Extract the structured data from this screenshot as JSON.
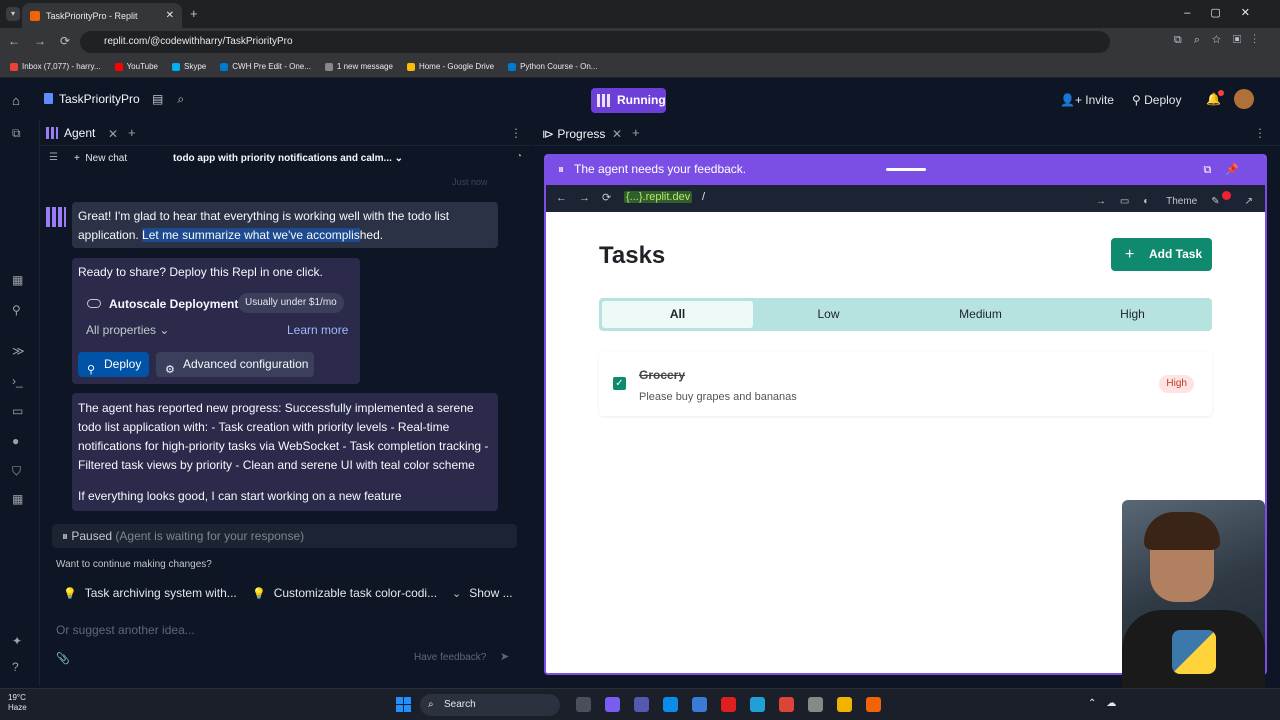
{
  "browser": {
    "tab_title": "TaskPriorityPro - Replit",
    "url": "replit.com/@codewithharry/TaskPriorityPro",
    "bookmarks": [
      "Inbox (7,077) - harry...",
      "YouTube",
      "Skype",
      "CWH Pre Edit - One...",
      "1 new message",
      "Home - Google Drive",
      "Python Course - On..."
    ]
  },
  "header": {
    "project_name": "TaskPriorityPro",
    "status": "Running",
    "invite": "Invite",
    "deploy": "Deploy"
  },
  "agent": {
    "tab_label": "Agent",
    "new_chat": "New chat",
    "chat_title": "todo app with priority notifications and calm...",
    "time": "Just now",
    "message1_a": "Great! I'm glad to hear that everything is working well with the todo list application. ",
    "message1_b": "Let me summarize what we've accomplis",
    "message1_c": "hed.",
    "deploy_card": {
      "question": "Ready to share? Deploy this Repl in one click.",
      "deployment_type": "Autoscale Deployment",
      "price": "Usually under $1/mo",
      "all_properties": "All properties",
      "learn_more": "Learn more",
      "deploy_button": "Deploy",
      "advanced_button": "Advanced configuration"
    },
    "message2": "The agent has reported new progress: Successfully implemented a serene todo list application with: - Task creation with priority levels - Real-time notifications for high-priority tasks via WebSocket - Task completion tracking - Filtered task views by priority - Clean and serene UI with teal color scheme",
    "message3": "If everything looks good, I can start working on a new feature",
    "paused_label": "Paused",
    "paused_note": "(Agent is waiting for your response)",
    "continue_prompt": "Want to continue making changes?",
    "suggestions": [
      "Task archiving system with...",
      "Customizable task color-codi...",
      "Show ..."
    ],
    "input_placeholder": "Or suggest another idea...",
    "feedback": "Have feedback?"
  },
  "progress": {
    "tab_label": "Progress",
    "banner": "The agent needs your feedback.",
    "domain": "{...}.replit.dev",
    "path": "/",
    "theme": "Theme"
  },
  "app": {
    "heading": "Tasks",
    "add_task": "Add Task",
    "filters": [
      "All",
      "Low",
      "Medium",
      "High"
    ],
    "active_filter": "All",
    "tasks": [
      {
        "title": "Grocery",
        "description": "Please buy grapes and bananas",
        "priority": "High",
        "completed": true
      }
    ],
    "accent_color": "#0f8a6e"
  },
  "taskbar": {
    "temp": "19°C",
    "weather": "Haze",
    "search": "Search"
  },
  "colors": {
    "background": "#0e1525",
    "running": "#6b3fd8",
    "banner": "#7b4fe6",
    "deploy_button": "#0053a6"
  }
}
